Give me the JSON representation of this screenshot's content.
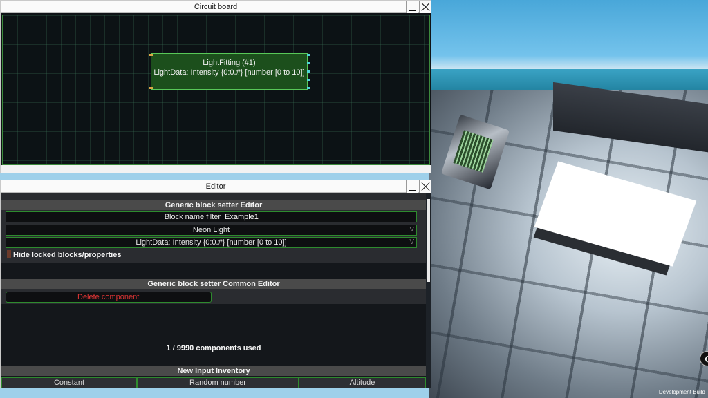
{
  "circuit_window": {
    "title": "Circuit board",
    "node": {
      "title": "LightFitting (#1)",
      "property": "LightData: Intensity {0:0.#} [number [0 to 10]]"
    }
  },
  "editor_window": {
    "title": "Editor",
    "setter_section": {
      "header": "Generic block setter Editor",
      "filter_label": "Block name filter",
      "filter_value": "Example1",
      "block_dropdown": "Neon Light",
      "property_dropdown": "LightData: Intensity {0:0.#} [number [0 to 10]]",
      "dropdown_arrow": "V",
      "hide_locked_label": "Hide locked blocks/properties"
    },
    "common_section": {
      "header": "Generic block setter Common Editor",
      "delete_label": "Delete component"
    },
    "usage": "1 / 9990 components used",
    "inventory": {
      "header": "New Input Inventory",
      "items": [
        "Constant",
        "Random number",
        "Altitude"
      ]
    }
  },
  "overlay": {
    "dev_build": "Development Build"
  },
  "colors": {
    "node_fill": "#1c4f1c",
    "border_green": "#2e8b2e",
    "delete_red": "#e23535"
  }
}
